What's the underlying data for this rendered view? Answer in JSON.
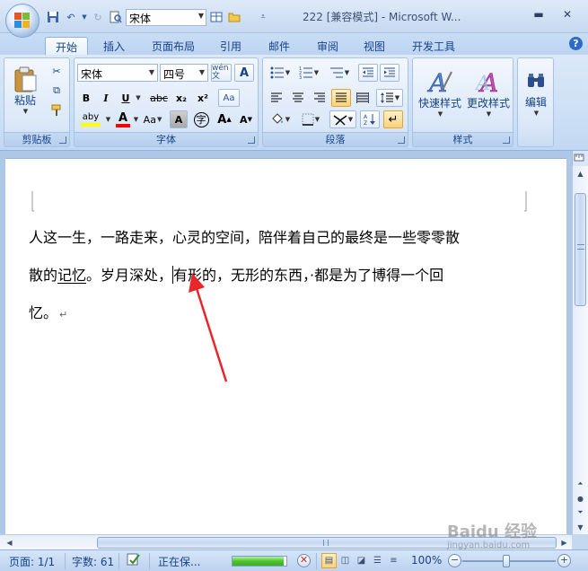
{
  "window": {
    "title": "222 [兼容模式] - Microsoft W...",
    "controls": [
      "minimize-icon",
      "restore-icon",
      "close-icon"
    ]
  },
  "quick_access": {
    "font_value": "宋体",
    "icons": [
      "save-icon",
      "undo-icon",
      "redo-icon",
      "print-preview-icon",
      "table-icon",
      "open-folder-icon",
      "customize-icon"
    ]
  },
  "tabs": [
    "开始",
    "插入",
    "页面布局",
    "引用",
    "邮件",
    "审阅",
    "视图",
    "开发工具"
  ],
  "active_tab": "开始",
  "ribbon": {
    "clipboard": {
      "label": "剪贴板",
      "paste_label": "粘贴"
    },
    "font": {
      "label": "字体",
      "font_name": "宋体",
      "font_size": "四号",
      "phonetic_label": "wén 文",
      "border_char_label": "A",
      "bold": "B",
      "italic": "I",
      "underline": "U",
      "strikethrough": "abc",
      "subscript": "x₂",
      "superscript": "x²",
      "clear_format": "Aa",
      "highlight": "aby",
      "font_color": "A",
      "case": "Aa",
      "char_shading": "A",
      "enclose": "字",
      "grow_font": "A",
      "shrink_font": "A",
      "highlight_color": "#ffff00",
      "font_color_value": "#ff0000"
    },
    "paragraph": {
      "label": "段落"
    },
    "styles": {
      "label": "样式",
      "quick_styles": "快速样式",
      "change_styles": "更改样式"
    },
    "editing": {
      "label": "编辑"
    }
  },
  "document": {
    "line1": "人这一生，一路走来，心灵的空间，陪伴着自己的最终是一些零零散",
    "line2_start": "散的",
    "line2_underlined": "记忆",
    "line2_mid": "。岁月深处，",
    "line2_end": "有形的，无形的东西，·都是为了博得一个回",
    "line3": "忆。",
    "para_mark": "↵"
  },
  "statusbar": {
    "page": "页面: 1/1",
    "words": "字数: 61",
    "saving": "正在保...",
    "progress": 0.95,
    "zoom": "100%"
  },
  "watermark": {
    "main": "Baidu 经验",
    "sub": "jingyan.baidu.com"
  },
  "colors": {
    "arrow": "#e8262b",
    "ribbon_bg": "#dbe8f8"
  }
}
